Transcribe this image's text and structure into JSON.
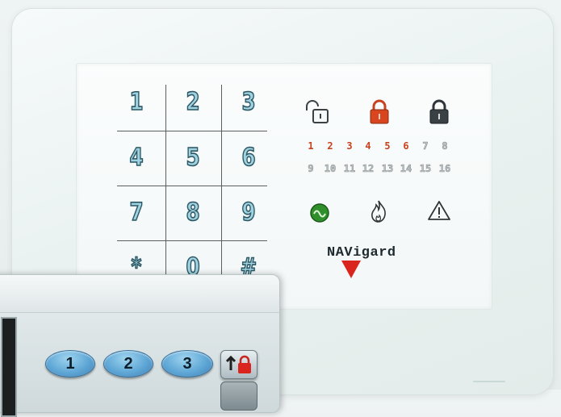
{
  "keypad": {
    "keys": [
      "1",
      "2",
      "3",
      "4",
      "5",
      "6",
      "7",
      "8",
      "9",
      "*",
      "0",
      "#"
    ]
  },
  "indicators": {
    "icons": [
      "unlocked-padlock-icon",
      "red-padlock-icon",
      "locked-padlock-icon"
    ],
    "zones_row1": [
      "1",
      "2",
      "3",
      "4",
      "5",
      "6",
      "7",
      "8"
    ],
    "zones_row2": [
      "9",
      "10",
      "11",
      "12",
      "13",
      "14",
      "15",
      "16"
    ],
    "zones_active": 6,
    "status_icons": [
      "power-icon",
      "fire-icon",
      "warning-icon"
    ]
  },
  "brand": {
    "logo_text": "NAVigard"
  },
  "foreground_keypad": {
    "keys": [
      "1",
      "2",
      "3"
    ],
    "lock_icon": "arm-lock-icon"
  },
  "colors": {
    "digit_fill": "#9fd3e2",
    "digit_outline": "#2f5560",
    "zone_active": "#c8421e",
    "power_green": "#2f8f2a",
    "lock_red": "#d9451e",
    "button_blue": "#5fa7d6"
  }
}
